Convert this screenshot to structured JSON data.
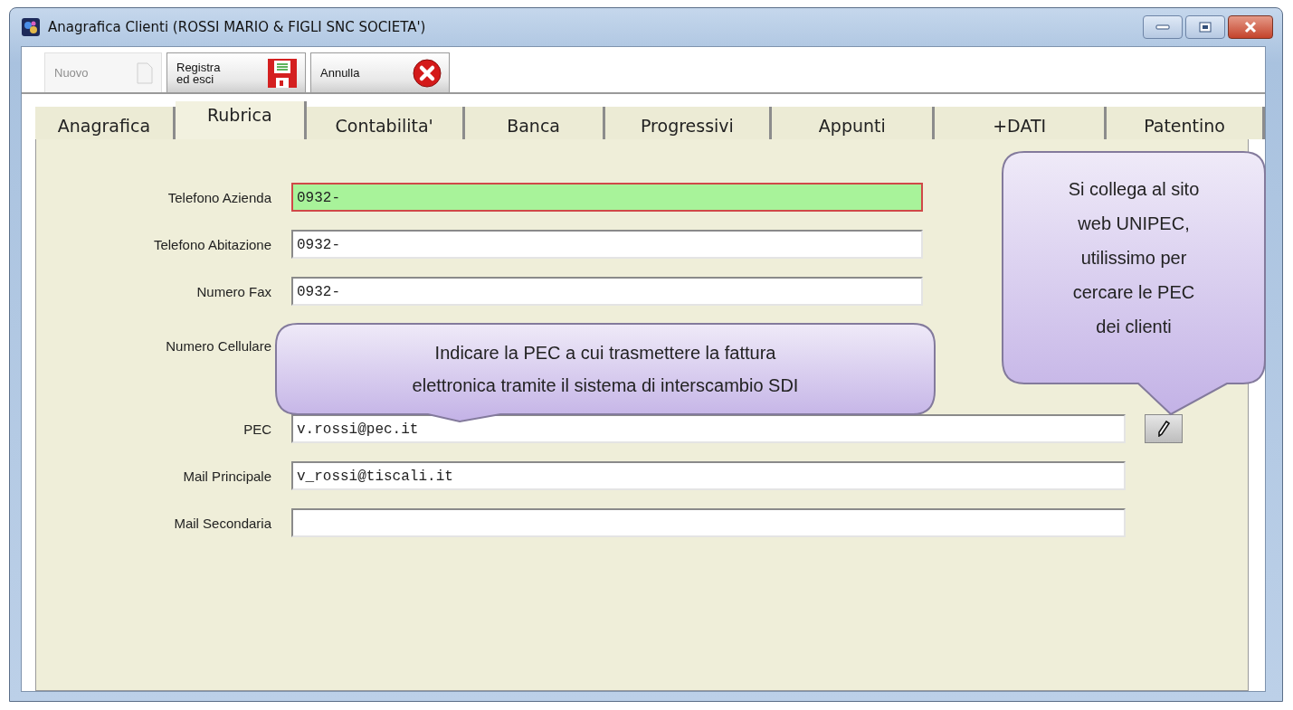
{
  "window": {
    "title": "Anagrafica Clienti (ROSSI MARIO & FIGLI SNC SOCIETA')"
  },
  "toolbar": [
    {
      "kind": "new",
      "label": "Nuovo",
      "disabled": true
    },
    {
      "kind": "save",
      "label": "Registra\ned esci",
      "disabled": false
    },
    {
      "kind": "cancel",
      "label": "Annulla",
      "disabled": false
    }
  ],
  "tabs": [
    {
      "label": "Anagrafica",
      "selected": false
    },
    {
      "label": "Rubrica",
      "selected": true
    },
    {
      "label": "Contabilita'",
      "selected": false
    },
    {
      "label": "Banca",
      "selected": false
    },
    {
      "label": "Progressivi",
      "selected": false
    },
    {
      "label": "Appunti",
      "selected": false
    },
    {
      "label": "+DATI",
      "selected": false
    },
    {
      "label": "Patentino",
      "selected": false
    }
  ],
  "fields": [
    {
      "kind": "short",
      "label": "Telefono Azienda",
      "value": "0932-",
      "focused": true
    },
    {
      "kind": "short",
      "label": "Telefono Abitazione",
      "value": "0932-",
      "focused": false
    },
    {
      "kind": "short",
      "label": "Numero Fax",
      "value": "0932-",
      "focused": false
    },
    {
      "kind": "covered",
      "label": "Numero Cellulare"
    },
    {
      "kind": "long",
      "label": "PEC",
      "value": "v.rossi@pec.it",
      "focused": false,
      "lookup_button": true
    },
    {
      "kind": "long",
      "label": "Mail Principale",
      "value": "v_rossi@tiscali.it",
      "focused": false
    },
    {
      "kind": "long",
      "label": "Mail Secondaria",
      "focused": false
    }
  ],
  "callouts": [
    {
      "kind": "wide",
      "text": "Indicare la PEC a cui trasmettere la fattura\nelettronica tramite il  sistema di interscambio SDI"
    },
    {
      "kind": "tall",
      "text": "Si collega al sito\nweb UNIPEC,\nutilissimo per\ncercare le PEC\ndei clienti"
    }
  ]
}
